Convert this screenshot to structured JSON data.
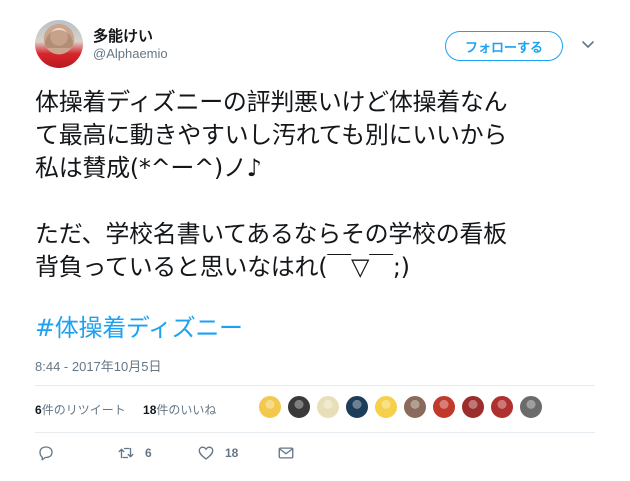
{
  "user": {
    "display_name": "多能けい",
    "handle": "@Alphaemio",
    "avatar": "user-avatar"
  },
  "follow_button": {
    "label": "フォローする"
  },
  "tweet": {
    "text": "体操着ディズニーの評判悪いけど体操着なん\nて最高に動きやすいし汚れても別にいいから\n私は賛成(*^ー^)ノ♪\n\nただ、学校名書いてあるならその学校の看板\n背負っていると思いなはれ(￣▽￣;)",
    "hashtag": "#体操着ディズニー",
    "timestamp": "8:44 - 2017年10月5日"
  },
  "stats": {
    "retweets_count": "6",
    "retweets_label": "件のリツイート",
    "likes_count": "18",
    "likes_label": "件のいいね"
  },
  "likers": [
    {
      "name": "liker-1",
      "color": "#f2c94c"
    },
    {
      "name": "liker-2",
      "color": "#3a3a3a"
    },
    {
      "name": "liker-3",
      "color": "#e8dfb8"
    },
    {
      "name": "liker-4",
      "color": "#1e3d59"
    },
    {
      "name": "liker-5",
      "color": "#f5d04a"
    },
    {
      "name": "liker-6",
      "color": "#8a6a5a"
    },
    {
      "name": "liker-7",
      "color": "#c0392b"
    },
    {
      "name": "liker-8",
      "color": "#9b2d2d"
    },
    {
      "name": "liker-9",
      "color": "#b03030"
    },
    {
      "name": "liker-10",
      "color": "#6b6b6b"
    }
  ],
  "actions": {
    "reply_icon": "reply-icon",
    "retweet_icon": "retweet-icon",
    "retweet_count": "6",
    "like_icon": "heart-icon",
    "like_count": "18",
    "dm_icon": "envelope-icon"
  },
  "colors": {
    "accent": "#1da1f2",
    "secondary_text": "#657786",
    "divider": "#e6ecf0"
  }
}
